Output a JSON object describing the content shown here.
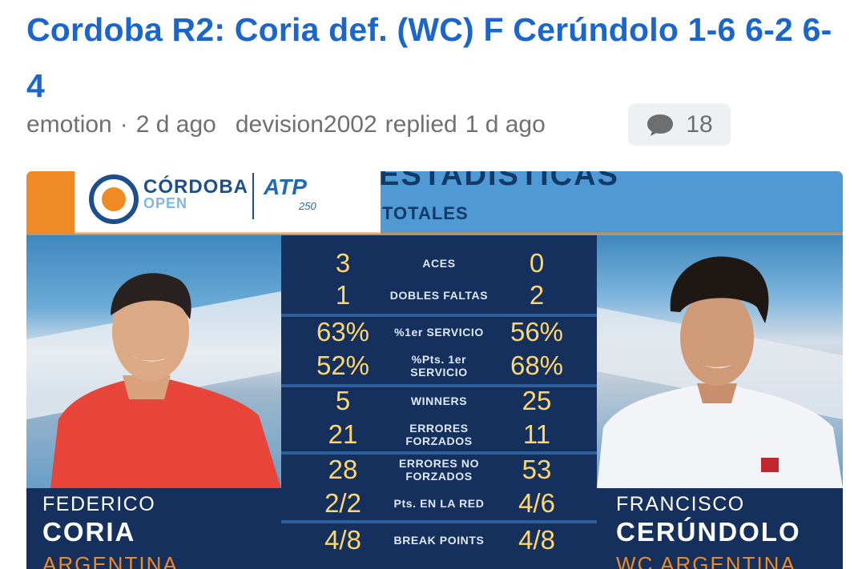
{
  "post": {
    "title": "Cordoba R2: Coria def. (WC) F Cerúndolo 1-6 6-2 6-4",
    "author": "emotion",
    "posted": "2 d ago",
    "replier": "devision2002",
    "replied_label": "replied",
    "replied_time": "1 d ago",
    "comment_count": "18",
    "icons": {
      "comments": "speech-bubble-icon"
    }
  },
  "graphic": {
    "brand_top": "CÓRDOBA",
    "brand_bottom": "OPEN",
    "tour": "ATP",
    "tour_level": "250",
    "heading": "ESTADISTICAS",
    "subheading": "TOTALES",
    "left_player": {
      "first": "FEDERICO",
      "last": "CORIA",
      "country": "ARGENTINA"
    },
    "right_player": {
      "first": "FRANCISCO",
      "last": "CERÚNDOLO",
      "country": "WC ARGENTINA"
    },
    "colors": {
      "accent_orange": "#f08a24",
      "panel_navy": "#15305c",
      "value_yellow": "#ffd66b",
      "title_blue": "#1a66cc"
    },
    "stats": [
      {
        "label": "ACES",
        "left": "3",
        "right": "0"
      },
      {
        "label": "DOBLES FALTAS",
        "left": "1",
        "right": "2"
      },
      {
        "label": "%1er SERVICIO",
        "left": "63%",
        "right": "56%"
      },
      {
        "label": "%Pts. 1er SERVICIO",
        "left": "52%",
        "right": "68%"
      },
      {
        "label": "WINNERS",
        "left": "5",
        "right": "25"
      },
      {
        "label": "ERRORES FORZADOS",
        "left": "21",
        "right": "11"
      },
      {
        "label": "ERRORES NO FORZADOS",
        "left": "28",
        "right": "53"
      },
      {
        "label": "Pts. EN LA RED",
        "left": "2/2",
        "right": "4/6"
      },
      {
        "label": "BREAK POINTS",
        "left": "4/8",
        "right": "4/8"
      }
    ]
  }
}
